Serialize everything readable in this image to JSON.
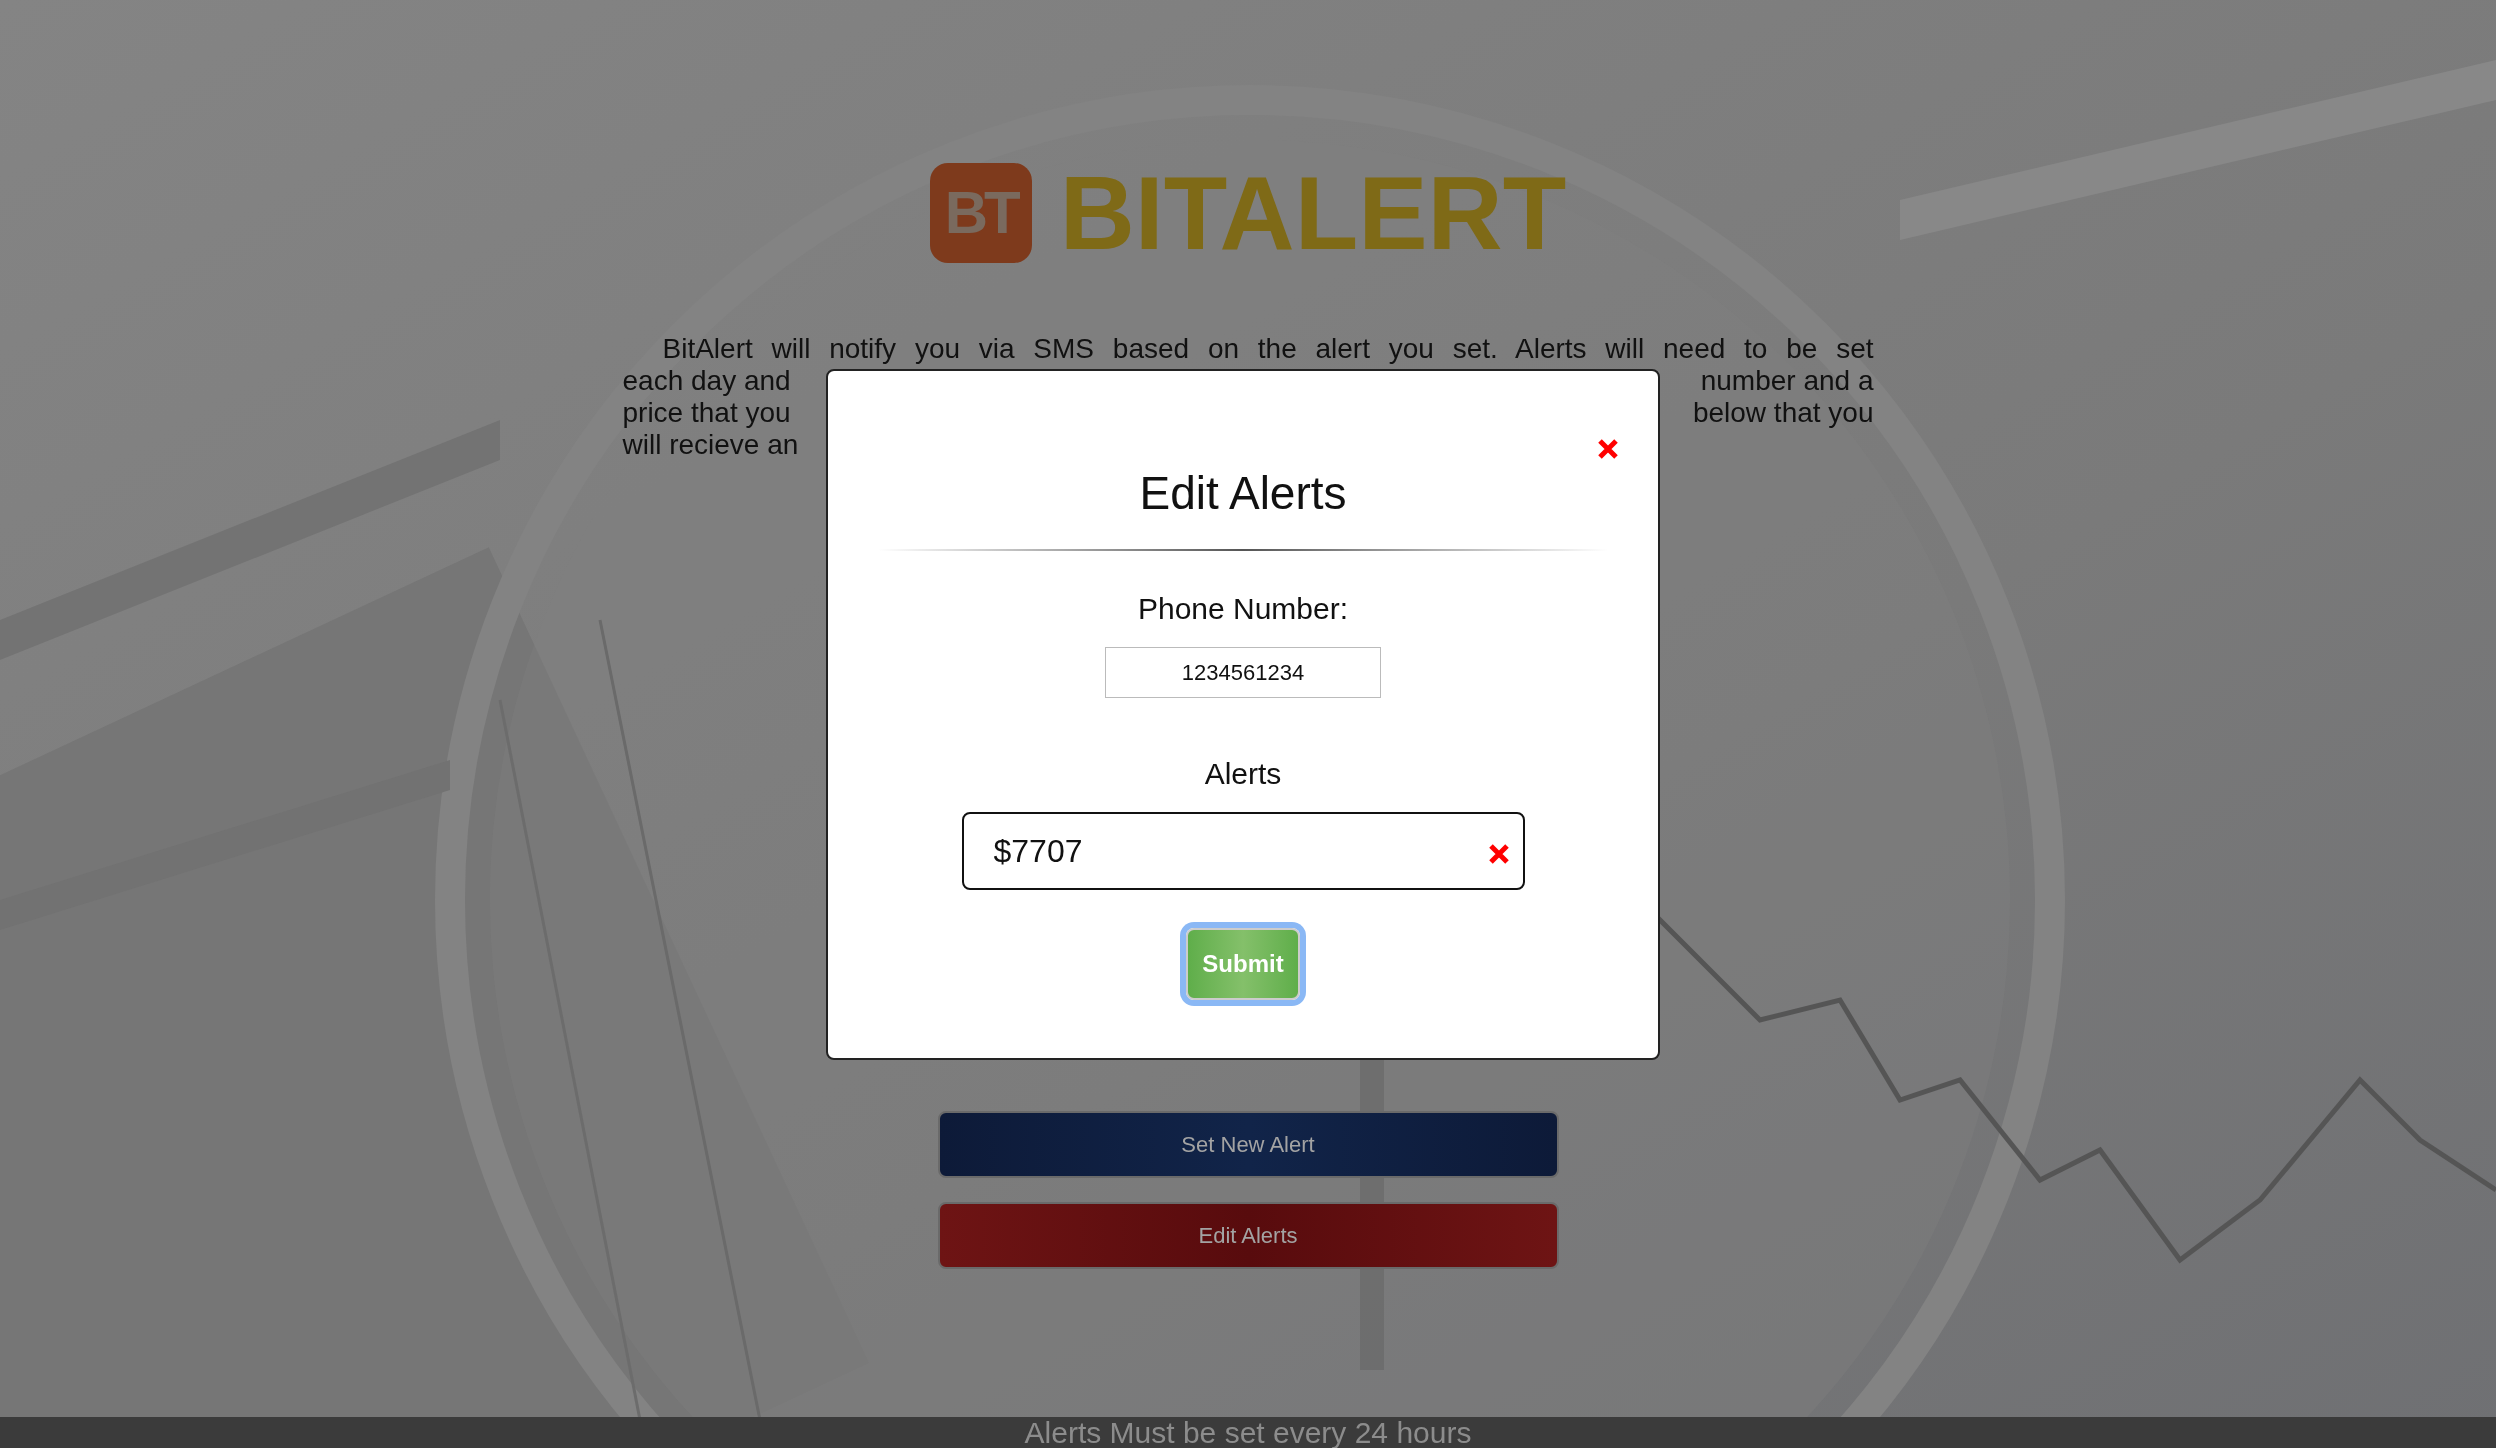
{
  "logo": {
    "mark": "BT",
    "wordmark": "BITALERT"
  },
  "intro": {
    "first_line": "BitAlert will notify you via SMS based on the alert you set. Alerts will need to be set",
    "fragments": [
      {
        "left": "each day and",
        "right": "number and a"
      },
      {
        "left": "price that you",
        "right": "below that you"
      },
      {
        "left": "will recieve an"
      }
    ]
  },
  "buttons": [
    {
      "label": "Set New Alert",
      "kind": "primary"
    },
    {
      "label": "Edit Alerts",
      "kind": "danger"
    }
  ],
  "footer": "Alerts Must be set every 24 hours",
  "modal": {
    "title": "Edit Alerts",
    "phone": {
      "label": "Phone Number:",
      "value": "1234561234"
    },
    "alerts": {
      "label": "Alerts",
      "value": "$7707"
    },
    "submit": {
      "label": "Submit",
      "focused": true
    }
  }
}
